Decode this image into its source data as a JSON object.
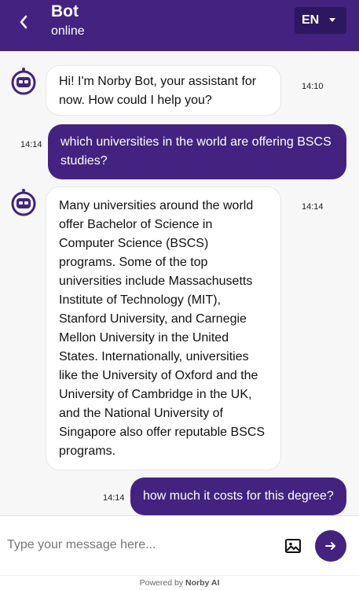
{
  "header": {
    "bot_name": "Bot",
    "status": "online",
    "language": "EN",
    "back_icon": "chevron-left-icon",
    "accent_color": "#43237f"
  },
  "messages": [
    {
      "sender": "bot",
      "time": "14:10",
      "text": "Hi! I'm Norby Bot, your assistant for now. How could I help you?"
    },
    {
      "sender": "user",
      "time": "14:14",
      "text": "which universities in the world are offering BSCS studies?"
    },
    {
      "sender": "bot",
      "time": "14:14",
      "text": "Many universities around the world offer Bachelor of Science in Computer Science (BSCS) programs. Some of the top universities include Massachusetts Institute of Technology (MIT), Stanford University, and Carnegie Mellon University in the United States. Internationally, universities like the University of Oxford and the University of Cambridge in the UK, and the National University of Singapore also offer reputable BSCS programs."
    },
    {
      "sender": "user",
      "time": "14:14",
      "text": "how much it costs for this degree?"
    }
  ],
  "composer": {
    "placeholder": "Type your message here...",
    "image_icon": "image-icon",
    "send_icon": "arrow-right-icon"
  },
  "footer": {
    "prefix": "Powered by ",
    "brand": "Norby AI"
  }
}
